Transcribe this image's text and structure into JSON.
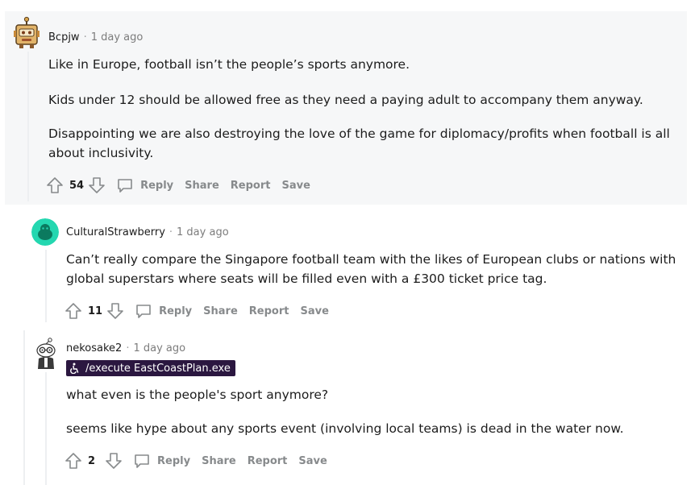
{
  "comments": [
    {
      "username": "Bcpjw",
      "time": "1 day ago",
      "paragraphs": [
        "Like in Europe, football isn’t the people’s sports anymore.",
        "Kids under 12 should be allowed free as they need a paying adult to accompany them anyway.",
        "Disappointing we are also destroying the love of the game for diplomacy/profits when football is all about inclusivity."
      ],
      "score": "54"
    },
    {
      "username": "CulturalStrawberry",
      "time": "1 day ago",
      "paragraphs": [
        "Can’t really compare the Singapore football team with the likes of European clubs or nations with global superstars where seats will be filled even with a £300 ticket price tag."
      ],
      "score": "11"
    },
    {
      "username": "nekosake2",
      "time": "1 day ago",
      "flair": "/execute EastCoastPlan.exe",
      "paragraphs": [
        "what even is the people's sport anymore?",
        "seems like hype about any sports event (involving local teams) is dead in the water now."
      ],
      "score": "2"
    }
  ],
  "actions": {
    "reply": "Reply",
    "share": "Share",
    "report": "Report",
    "save": "Save"
  },
  "separator": "·",
  "colors": {
    "highlight_bg": "#f6f7f8",
    "flair_bg": "#2b1740",
    "action_text": "#878a8c",
    "avatar_teal": "#24d7b0"
  },
  "icons": {
    "upvote": "arrow-up-outline-icon",
    "downvote": "arrow-down-outline-icon",
    "reply": "speech-bubble-icon",
    "flair": "accessibility-icon"
  }
}
